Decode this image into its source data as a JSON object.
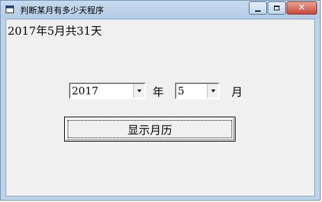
{
  "window": {
    "title": "判断某月有多少天程序",
    "icon": "app-window-icon",
    "controls": [
      "minimize-icon",
      "maximize-icon",
      "close-icon"
    ],
    "close_glyph": "✕"
  },
  "form": {
    "result_text": "2017年5月共31天",
    "year": {
      "selected": "2017",
      "unit_label": "年"
    },
    "month": {
      "selected": "5",
      "unit_label": "月"
    },
    "show_button_label": "显示月历"
  },
  "colors": {
    "title_bar": "#bcd3ea",
    "client_bg": "#f0f0f0",
    "close_button": "#c8483a"
  }
}
